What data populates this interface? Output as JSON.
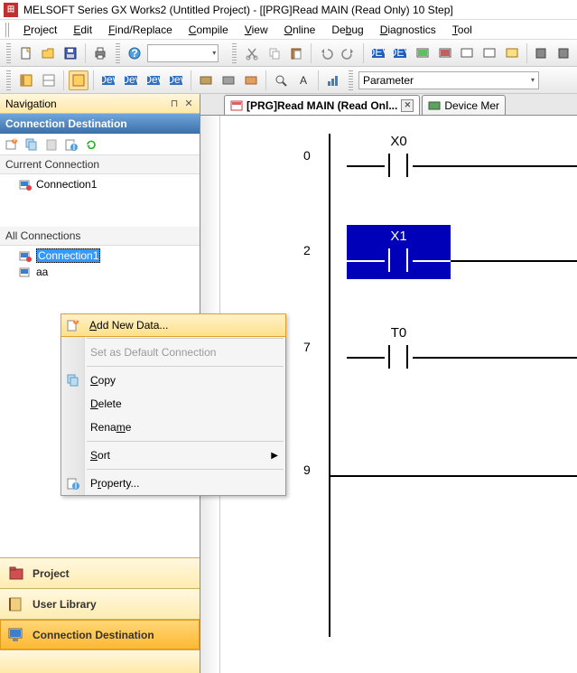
{
  "title": "MELSOFT Series GX Works2 (Untitled Project) - [[PRG]Read MAIN (Read Only) 10 Step]",
  "menu": {
    "project": "Project",
    "edit": "Edit",
    "find": "Find/Replace",
    "compile": "Compile",
    "view": "View",
    "online": "Online",
    "debug": "Debug",
    "diagnostics": "Diagnostics",
    "tool": "Tool"
  },
  "toolbar": {
    "param_label": "Parameter"
  },
  "nav": {
    "title": "Navigation",
    "section": "Connection Destination",
    "current": "Current Connection",
    "conn1": "Connection1",
    "all": "All Connections",
    "conn_sel": "Connection1",
    "aa": "aa",
    "btn_project": "Project",
    "btn_userlib": "User Library",
    "btn_conn": "Connection Destination"
  },
  "tabs": {
    "t1": "[PRG]Read MAIN (Read Onl...",
    "t2": "Device Mer"
  },
  "ladder": {
    "r0_num": "0",
    "r0_dev": "X0",
    "r1_num": "2",
    "r1_dev": "X1",
    "r2_num": "7",
    "r2_dev": "T0",
    "r3_num": "9"
  },
  "ctx": {
    "add_new": "Add New Data...",
    "set_default": "Set as Default Connection",
    "copy": "Copy",
    "delete": "Delete",
    "rename": "Rename",
    "sort": "Sort",
    "property": "Property..."
  }
}
